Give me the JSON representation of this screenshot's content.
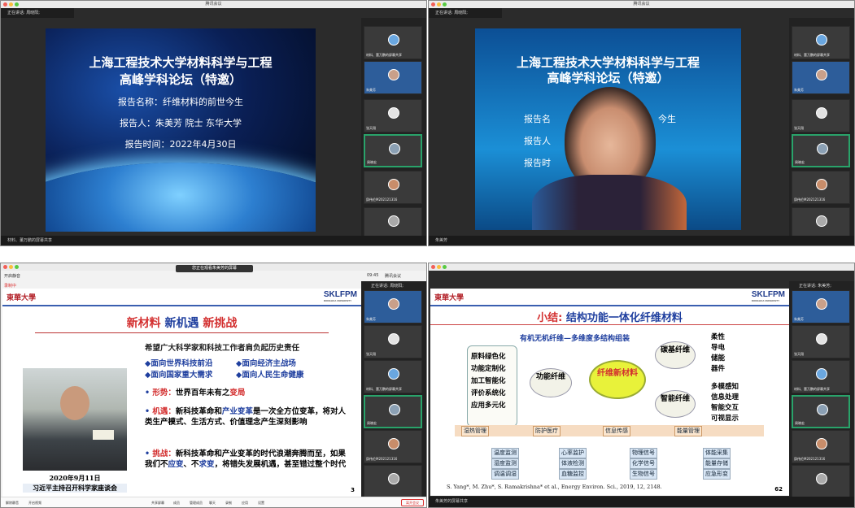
{
  "window_title": "腾讯会议",
  "q1": {
    "speaker": "正在讲话: 周晓阳;",
    "title1": "上海工程技术大学材料科学与工程",
    "title2": "高峰学科论坛（特邀）",
    "line1": "报告名称：纤维材料的前世今生",
    "line2": "报告人：朱美芳 院士 东华大学",
    "line3": "报告时间：2022年4月30日",
    "status": "材料、董万鹏的屏幕共享"
  },
  "q2": {
    "speaker": "正在讲话: 周晓阳;",
    "title1": "上海工程技术大学材料科学与工程",
    "title2": "高峰学科论坛（特邀）",
    "line1": "报告名",
    "line1b": "今生",
    "line2": "报告人",
    "line3": "报告时",
    "status": "朱美芳"
  },
  "thumbs": {
    "t0": "材料、董万鹏的屏幕共享",
    "t1": "朱美芳",
    "t2": "张天翔",
    "t3": "周晓宏",
    "t4": "邱伟伦M202121316",
    "t5": "",
    "t0b": "材料、董万鹏的屏幕共享",
    "t1b": "朱美芳",
    "t2b": "张天翔",
    "t3b": "周晓宏",
    "t4b": "邱伟伦M202121316",
    "t5b": ""
  },
  "q3": {
    "banner": "您正在观看朱美芳的屏幕",
    "rec": "录制中",
    "mute": "开启静音",
    "time": "09:45",
    "meeting": "腾讯会议",
    "speaker": "正在讲话: 周晓阳;",
    "logo_left": "東華大學",
    "logo_right": "SKLFPM",
    "title_a": "新材料 ",
    "title_b": "新机遇 ",
    "title_c": "新挑战",
    "lead": "希望广大科学家和科技工作者肩负起历史责任",
    "d1": "面向世界科技前沿",
    "d2": "面向经济主战场",
    "d3": "面向国家重大需求",
    "d4": "面向人民生命健康",
    "b1a": "形势：",
    "b1b": "世界百年未有之",
    "b1c": "变局",
    "b2a": "机遇：",
    "b2b": "新科技革命和",
    "b2c": "产业变革",
    "b2d": "是一次全方位变革，将对人类生产模式、生活方式、价值理念产生深刻影响",
    "b3a": "挑战：",
    "b3b": "新科技革命和产业变革的时代浪潮奔腾而至，如果我们不",
    "b3c": "应变",
    "b3d": "、不",
    "b3e": "求变",
    "b3f": "，将错失发展机遇，甚至错过整个时代",
    "date": "2020年9月11日",
    "caption": "习近平主持召开科学家座谈会",
    "page": "3",
    "toolbar": [
      "解除静音",
      "开启视频",
      "共享屏幕",
      "成员",
      "管理成员",
      "聊天",
      "录制",
      "应用",
      "设置"
    ],
    "leave": "离开会议"
  },
  "q4": {
    "speaker": "正在讲话: 朱美芳;",
    "logo_left": "東華大學",
    "logo_right": "SKLFPM",
    "title_a": "小结: ",
    "title_b": "结构功能一体化纤维材料",
    "subtitle": "有机无机纤维—多维度多结构组装",
    "left_list": [
      "原料绿色化",
      "功能定制化",
      "加工智能化",
      "评价系统化",
      "应用多元化"
    ],
    "func": "功能纤维",
    "center": "纤维新材料",
    "carbon": "碳基纤维",
    "carbon_list": [
      "柔性",
      "导电",
      "储能",
      "器件"
    ],
    "smart": "智能纤维",
    "smart_list": [
      "多模感知",
      "信息处理",
      "智能交互",
      "可视显示"
    ],
    "cats": [
      "湿热管理",
      "防护医疗",
      "信息传感",
      "能量管理"
    ],
    "subs": [
      [
        "温度监测",
        "湿度监测",
        "调温调湿"
      ],
      [
        "心率监护",
        "体液检测",
        "血糖监控"
      ],
      [
        "物理信号",
        "化学信号",
        "生物信号"
      ],
      [
        "体能采集",
        "能量存储",
        "应急形变"
      ]
    ],
    "ref": "S. Yang*, M. Zhu*, S. Ramakrishna* et al., Energy Environ. Sci., 2019, 12, 2148.",
    "page": "62",
    "status": "朱美芳的屏幕共享"
  }
}
